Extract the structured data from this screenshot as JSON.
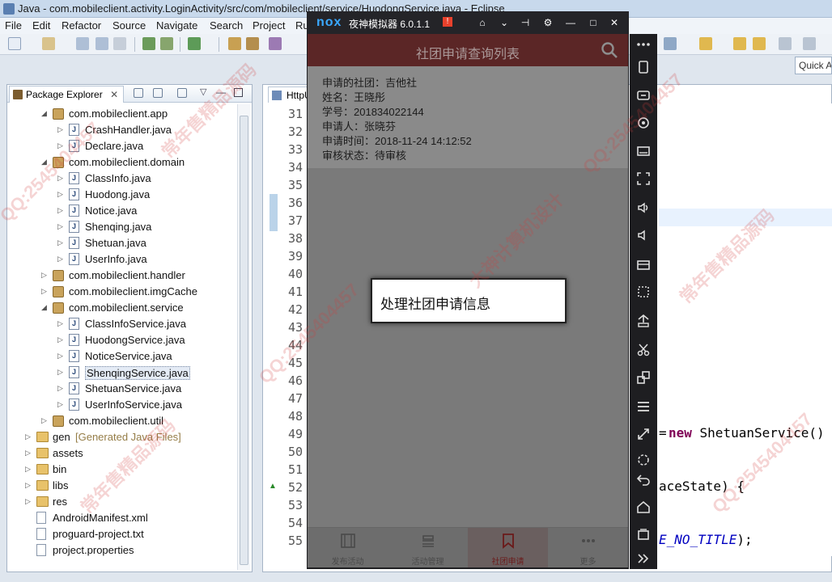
{
  "window": {
    "title": "Java - com.mobileclient.activity.LoginActivity/src/com/mobileclient/service/HuodongService.java - Eclipse"
  },
  "menu": [
    "File",
    "Edit",
    "Refactor",
    "Source",
    "Navigate",
    "Search",
    "Project",
    "Ru"
  ],
  "quick_access": "Quick A",
  "package_explorer": {
    "tab": "Package Explorer",
    "rows": [
      {
        "label": "com.mobileclient.app",
        "kind": "package",
        "expanded": true
      },
      {
        "label": "CrashHandler.java",
        "kind": "java"
      },
      {
        "label": "Declare.java",
        "kind": "java"
      },
      {
        "label": "com.mobileclient.domain",
        "kind": "package",
        "expanded": true
      },
      {
        "label": "ClassInfo.java",
        "kind": "java"
      },
      {
        "label": "Huodong.java",
        "kind": "java"
      },
      {
        "label": "Notice.java",
        "kind": "java"
      },
      {
        "label": "Shenqing.java",
        "kind": "java"
      },
      {
        "label": "Shetuan.java",
        "kind": "java"
      },
      {
        "label": "UserInfo.java",
        "kind": "java"
      },
      {
        "label": "com.mobileclient.handler",
        "kind": "package",
        "expanded": false
      },
      {
        "label": "com.mobileclient.imgCache",
        "kind": "package",
        "expanded": false
      },
      {
        "label": "com.mobileclient.service",
        "kind": "package",
        "expanded": true
      },
      {
        "label": "ClassInfoService.java",
        "kind": "java"
      },
      {
        "label": "HuodongService.java",
        "kind": "java"
      },
      {
        "label": "NoticeService.java",
        "kind": "java"
      },
      {
        "label": "ShenqingService.java",
        "kind": "java",
        "selected": true
      },
      {
        "label": "ShetuanService.java",
        "kind": "java"
      },
      {
        "label": "UserInfoService.java",
        "kind": "java"
      },
      {
        "label": "com.mobileclient.util",
        "kind": "package",
        "expanded": false
      },
      {
        "label": "gen",
        "extra": "[Generated Java Files]",
        "kind": "folder"
      },
      {
        "label": "assets",
        "kind": "folder"
      },
      {
        "label": "bin",
        "kind": "folder"
      },
      {
        "label": "libs",
        "kind": "folder"
      },
      {
        "label": "res",
        "kind": "folder"
      },
      {
        "label": "AndroidManifest.xml",
        "kind": "file"
      },
      {
        "label": "proguard-project.txt",
        "kind": "file"
      },
      {
        "label": "project.properties",
        "kind": "file"
      }
    ]
  },
  "editor": {
    "tab": "HttpU",
    "line_numbers": [
      "31",
      "32",
      "33",
      "34",
      "35",
      "36",
      "37",
      "38",
      "39",
      "40",
      "41",
      "42",
      "43",
      "44",
      "45",
      "46",
      "47",
      "48",
      "49",
      "50",
      "51",
      "52",
      "53",
      "54",
      "55"
    ],
    "code_fragments": {
      "new_kw": "new",
      "new_rest": " ShetuanService()",
      "instance_state": "aceState) {",
      "no_title_prefix": "E_NO_TITLE",
      "no_title_suffix": ");"
    }
  },
  "emulator": {
    "brand": "nox",
    "name": "夜神模拟器 6.0.1.1",
    "badge": "!",
    "app_title": "社团申请查询列表",
    "record": {
      "shetuan": "申请的社团：吉他社",
      "name": "姓名：王晓彤",
      "xuehao": "学号：201834022144",
      "applicant": "申请人：张晓芬",
      "time": "申请时间：2018-11-24 14:12:52",
      "status": "审核状态：待审核"
    },
    "dialog_message": "处理社团申请信息",
    "bottom_nav": [
      {
        "label": "发布活动",
        "icon": "film-icon"
      },
      {
        "label": "活动管理",
        "icon": "stack-icon"
      },
      {
        "label": "社团申请",
        "icon": "bookmark-icon",
        "active": true
      },
      {
        "label": "更多",
        "icon": "more-icon"
      }
    ]
  },
  "watermarks": [
    "QQ:2545404457",
    "常年售精品源码",
    "大神计算机设计"
  ]
}
